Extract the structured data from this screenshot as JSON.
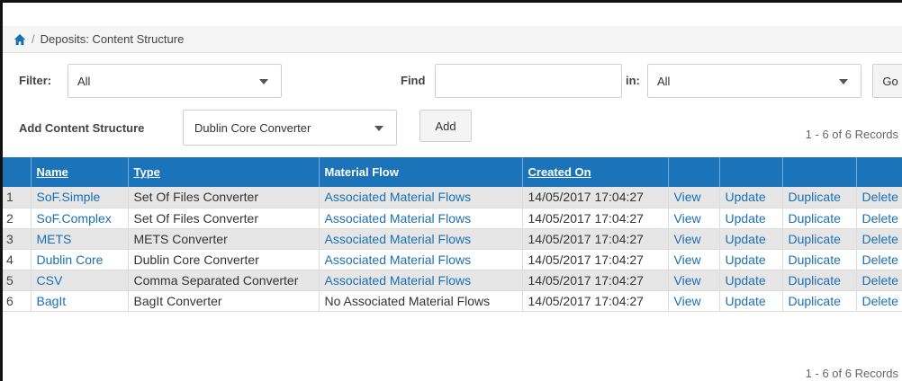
{
  "breadcrumb": {
    "separator": "/",
    "current": "Deposits: Content Structure"
  },
  "filter": {
    "label": "Filter:",
    "value": "All"
  },
  "find": {
    "label": "Find",
    "value": "",
    "in_label": "in:",
    "in_value": "All",
    "go_label": "Go"
  },
  "add": {
    "label": "Add Content Structure",
    "converter_value": "Dublin Core Converter",
    "button_label": "Add"
  },
  "records": {
    "top": "1 - 6 of 6 Records",
    "bottom": "1 - 6 of 6 Records"
  },
  "table": {
    "headers": [
      "",
      "Name",
      "Type",
      "Material Flow",
      "Created On",
      "",
      "",
      "",
      ""
    ],
    "rows": [
      {
        "num": "1",
        "name": "SoF.Simple",
        "type": "Set Of Files Converter",
        "flow": "Associated Material Flows",
        "created": "14/05/2017 17:04:27",
        "view": "View",
        "update": "Update",
        "duplicate": "Duplicate",
        "delete": "Delete"
      },
      {
        "num": "2",
        "name": "SoF.Complex",
        "type": "Set Of Files Converter",
        "flow": "Associated Material Flows",
        "created": "14/05/2017 17:04:27",
        "view": "View",
        "update": "Update",
        "duplicate": "Duplicate",
        "delete": "Delete"
      },
      {
        "num": "3",
        "name": "METS",
        "type": "METS Converter",
        "flow": "Associated Material Flows",
        "created": "14/05/2017 17:04:27",
        "view": "View",
        "update": "Update",
        "duplicate": "Duplicate",
        "delete": "Delete"
      },
      {
        "num": "4",
        "name": "Dublin Core",
        "type": "Dublin Core Converter",
        "flow": "Associated Material Flows",
        "created": "14/05/2017 17:04:27",
        "view": "View",
        "update": "Update",
        "duplicate": "Duplicate",
        "delete": "Delete"
      },
      {
        "num": "5",
        "name": "CSV",
        "type": "Comma Separated Converter",
        "flow": "Associated Material Flows",
        "created": "14/05/2017 17:04:27",
        "view": "View",
        "update": "Update",
        "duplicate": "Duplicate",
        "delete": "Delete"
      },
      {
        "num": "6",
        "name": "BagIt",
        "type": "BagIt Converter",
        "flow": "No Associated Material Flows",
        "created": "14/05/2017 17:04:27",
        "view": "View",
        "update": "Update",
        "duplicate": "Duplicate",
        "delete": "Delete"
      }
    ]
  },
  "colors": {
    "header_blue": "#1b73b9",
    "link_blue": "#1b6fb5",
    "row_alt": "#e6e6e6"
  },
  "icons": {
    "home": "home-icon",
    "caret": "chevron-down-icon"
  }
}
